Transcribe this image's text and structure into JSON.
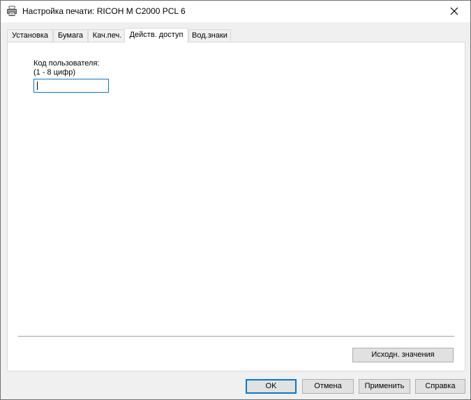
{
  "window": {
    "title": "Настройка печати: RICOH M C2000 PCL 6",
    "icon": "printer-icon",
    "close_icon": "close-icon"
  },
  "tabs": [
    {
      "label": "Установка",
      "active": false
    },
    {
      "label": "Бумага",
      "active": false
    },
    {
      "label": "Кач.печ.",
      "active": false
    },
    {
      "label": "Действ. доступ",
      "active": true
    },
    {
      "label": "Вод.знаки",
      "active": false
    }
  ],
  "panel": {
    "user_code_label": "Код пользователя:",
    "user_code_hint": "(1 - 8 цифр)",
    "user_code_value": "",
    "defaults_button": "Исходн. значения"
  },
  "footer": {
    "ok": "OK",
    "cancel": "Отмена",
    "apply": "Применить",
    "help": "Справка"
  },
  "colors": {
    "accent": "#0078d7",
    "panel_bg": "#ffffff",
    "window_bg": "#f0f0f0",
    "button_bg": "#e1e1e1"
  }
}
